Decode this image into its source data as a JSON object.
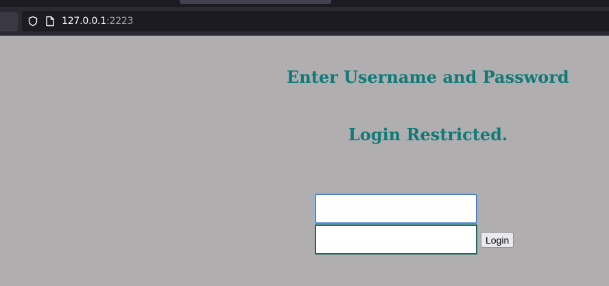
{
  "browser": {
    "url_host": "127.0.0.1",
    "url_port": ":2223"
  },
  "page": {
    "heading": "Enter Username and Password",
    "subheading": "Login Restricted.",
    "username_value": "",
    "password_value": "",
    "login_button": "Login"
  },
  "colors": {
    "page_background": "#b0aeaf",
    "heading_color": "#0f7a78"
  },
  "icons": {
    "security": "shield-icon",
    "page": "page-icon"
  }
}
